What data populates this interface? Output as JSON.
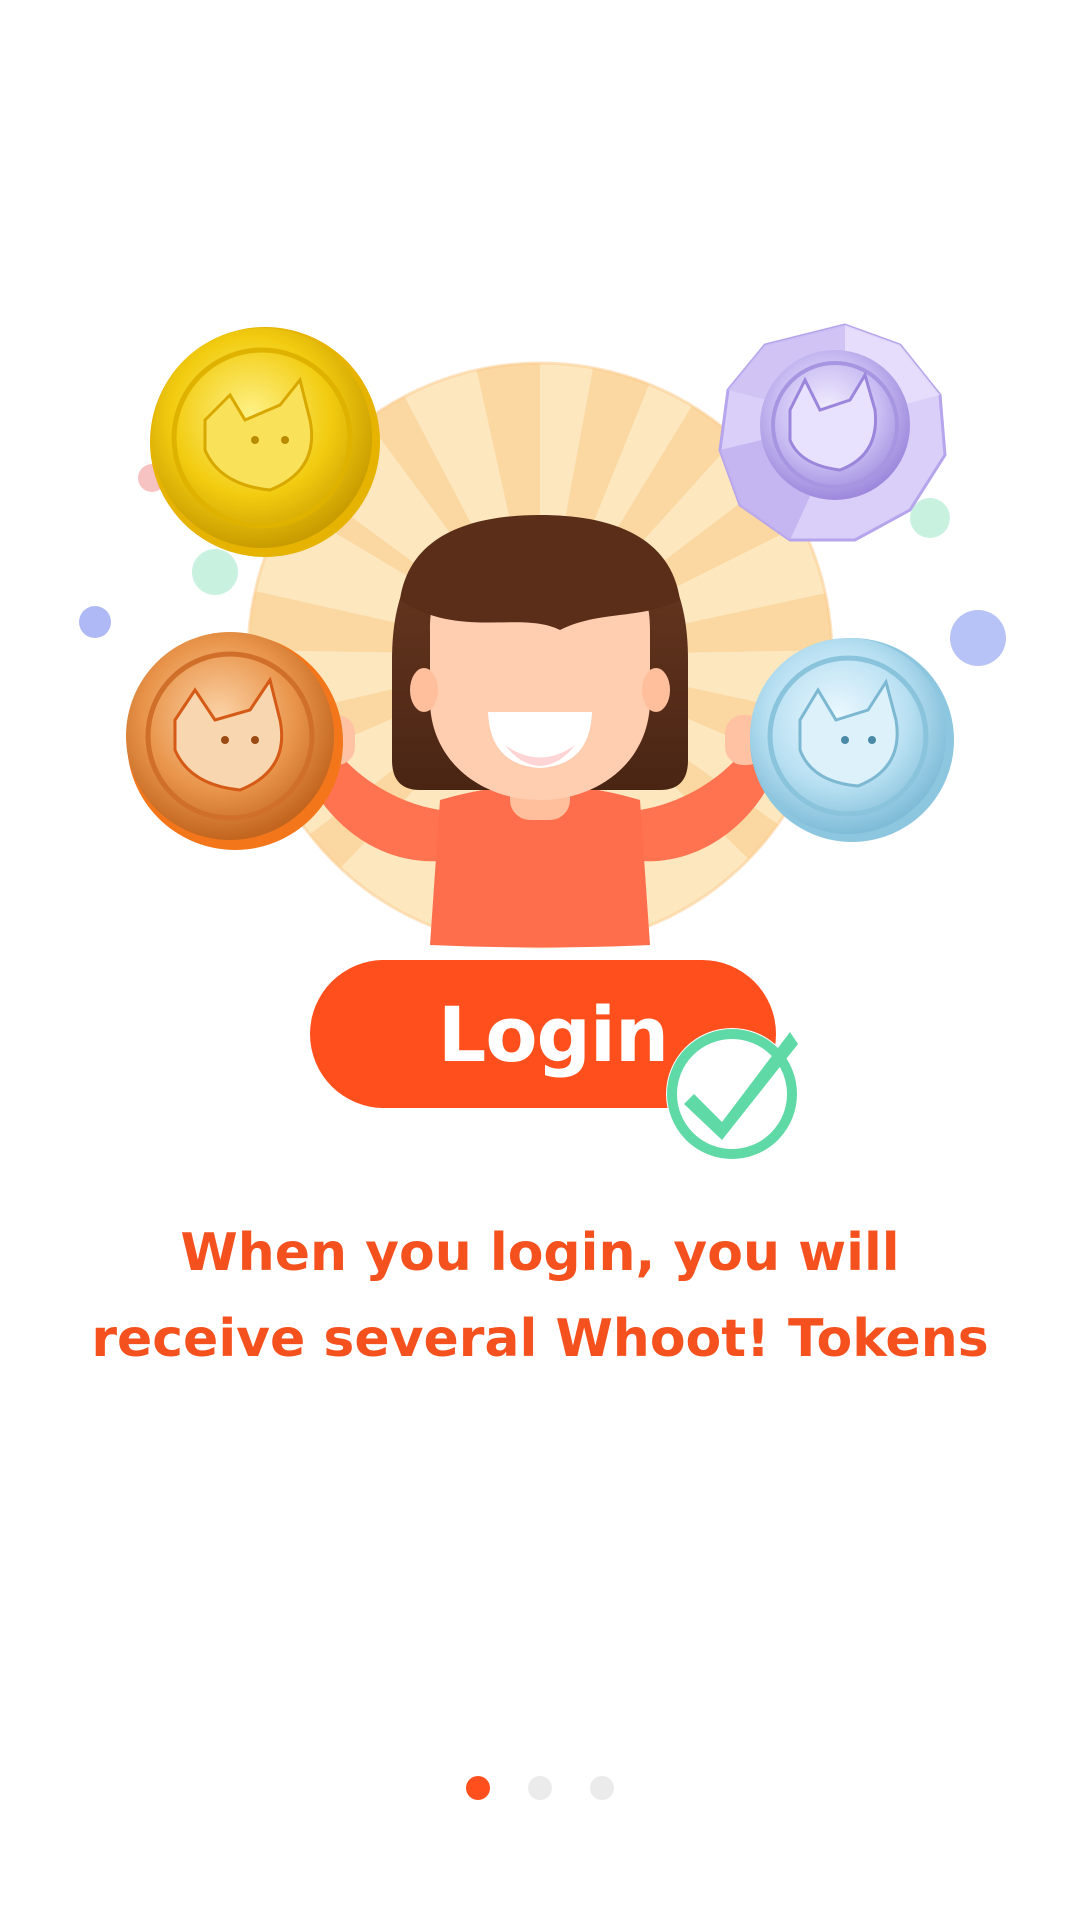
{
  "login_button": {
    "label": "Login"
  },
  "message": {
    "line1": "When you login, you will",
    "line2": "receive several Whoot! Tokens"
  },
  "tokens": {
    "gold": {
      "label": "Whoot Gold Token",
      "color": "#f2c700"
    },
    "bronze": {
      "label": "Whoot Bronze Token",
      "color": "#e8893c"
    },
    "silver": {
      "label": "Whoot Silver Token",
      "color": "#a9d8ec"
    },
    "diamond": {
      "color": "#b9a9ee"
    }
  },
  "pager": {
    "pages": 3,
    "active": 1
  },
  "colors": {
    "accent": "#ff4f1c",
    "text": "#f4511e",
    "check": "#5fd9a6",
    "dot_inactive": "#ebebeb"
  }
}
